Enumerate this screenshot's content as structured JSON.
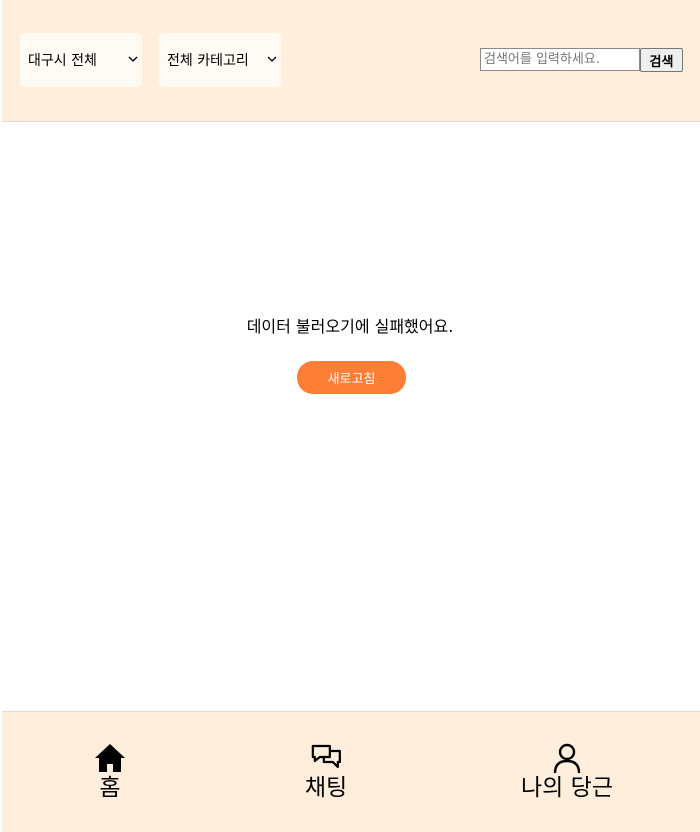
{
  "header": {
    "region_select": {
      "value": "대구시 전체"
    },
    "category_select": {
      "value": "전체 카테고리"
    },
    "search": {
      "placeholder": "검색어를 입력하세요.",
      "button_label": "검색"
    }
  },
  "main": {
    "error_message": "데이터 불러오기에 실패했어요.",
    "refresh_label": "새로고침",
    "accent_color": "#ff7e36"
  },
  "bottom_nav": {
    "items": [
      {
        "label": "홈",
        "icon": "home-icon"
      },
      {
        "label": "채팅",
        "icon": "chat-icon"
      },
      {
        "label": "나의 당근",
        "icon": "user-icon"
      }
    ]
  },
  "colors": {
    "header_bg": "#feeedb",
    "nav_bg": "#feeedb",
    "select_bg": "#fffaf4"
  }
}
